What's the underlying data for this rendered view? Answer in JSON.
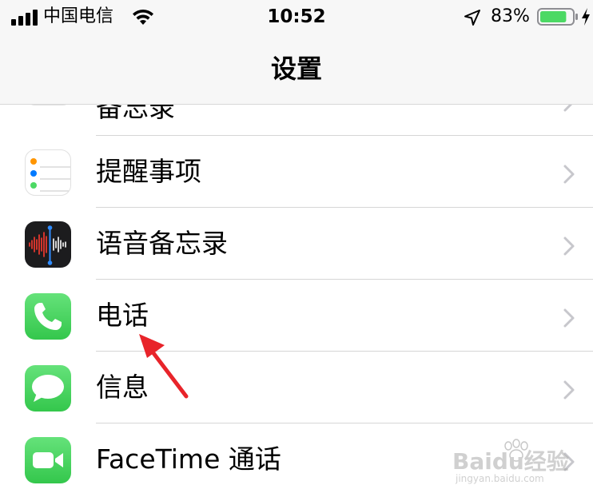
{
  "status_bar": {
    "carrier": "中国电信",
    "time": "10:52",
    "battery_percent": "83%",
    "battery_level": 0.83
  },
  "nav": {
    "title": "设置"
  },
  "rows": [
    {
      "label": "备忘录",
      "icon": "notes-icon"
    },
    {
      "label": "提醒事项",
      "icon": "reminders-icon"
    },
    {
      "label": "语音备忘录",
      "icon": "voice-memos-icon"
    },
    {
      "label": "电话",
      "icon": "phone-icon"
    },
    {
      "label": "信息",
      "icon": "messages-icon"
    },
    {
      "label": "FaceTime 通话",
      "icon": "facetime-icon"
    }
  ],
  "watermark": {
    "brand": "Baidu经验",
    "url": "jingyan.baidu.com"
  },
  "colors": {
    "phone_green": "#4cd964",
    "battery_green": "#4cd964",
    "arrow_red": "#e8242a",
    "chevron": "#c7c7cc"
  }
}
